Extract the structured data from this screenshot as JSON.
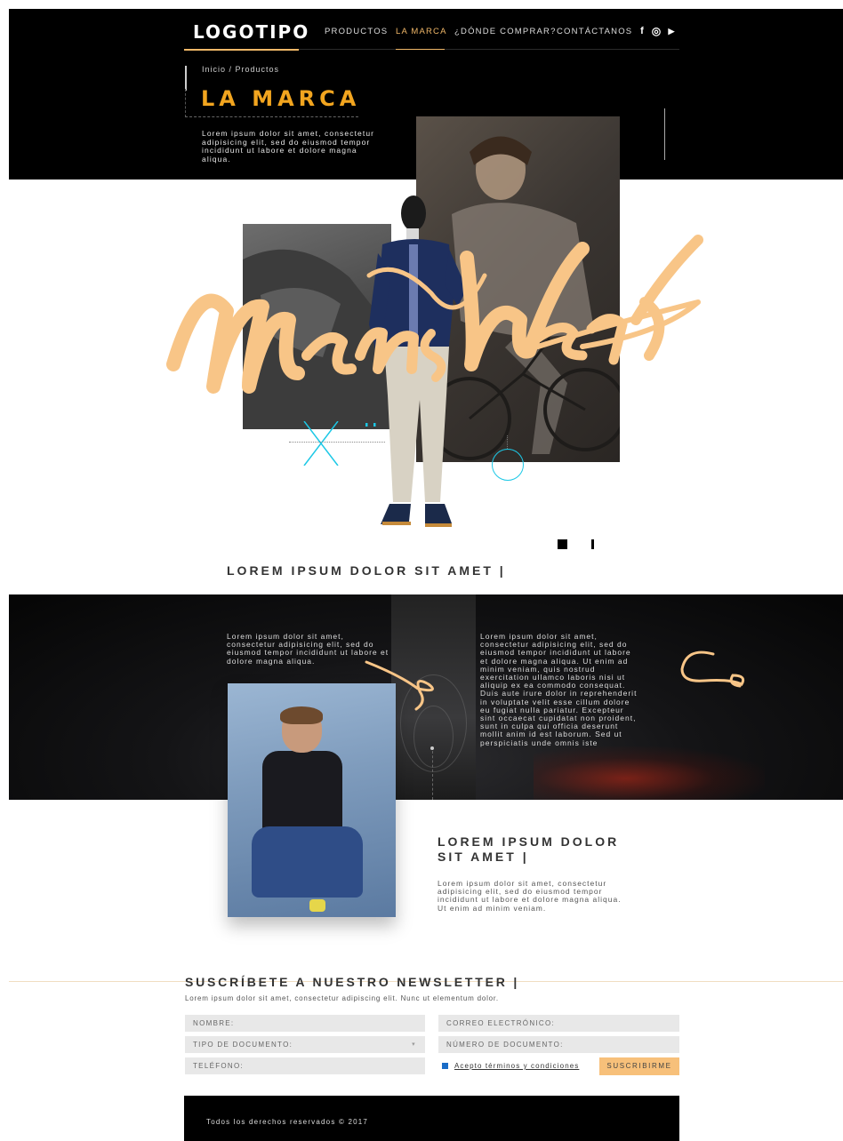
{
  "header": {
    "logo": "LOGOTIPO",
    "nav": [
      {
        "label": "PRODUCTOS",
        "active": false
      },
      {
        "label": "LA MARCA",
        "active": true
      },
      {
        "label": "¿DÓNDE COMPRAR?",
        "active": false
      },
      {
        "label": "CONTÁCTANOS",
        "active": false
      }
    ],
    "social": [
      "facebook-icon",
      "instagram-icon",
      "youtube-icon"
    ],
    "social_glyphs": [
      "f",
      "◎",
      "▶"
    ]
  },
  "hero": {
    "breadcrumb": "Inicio / Productos",
    "title": "LA MARCA",
    "intro": "Lorem ipsum dolor sit amet, consectetur adipisicing elit, sed do eiusmod tempor incididunt ut labore et dolore magna aliqua.",
    "script_text": "MensWear",
    "tagline": "LOREM IPSUM DOLOR SIT AMET   |"
  },
  "dark_section": {
    "text_left": "Lorem ipsum dolor sit amet, consectetur adipisicing elit, sed do eiusmod tempor incididunt ut labore et dolore magna aliqua.",
    "text_right": "Lorem ipsum dolor sit amet, consectetur adipisicing elit, sed do eiusmod tempor incididunt ut labore et dolore magna aliqua. Ut enim ad minim veniam, quis nostrud exercitation ullamco laboris nisi ut aliquip ex ea commodo consequat. Duis aute irure dolor in reprehenderit in voluptate velit esse cillum dolore eu fugiat nulla pariatur. Excepteur sint occaecat cupidatat non proident, sunt in culpa qui officia deserunt mollit anim id est laborum. Sed ut perspiciatis unde omnis iste"
  },
  "feature": {
    "title": "LOREM IPSUM DOLOR SIT AMET   |",
    "text": "Lorem ipsum dolor sit amet, consectetur adipisicing elit, sed do eiusmod tempor incididunt ut labore et dolore magna aliqua. Ut enim ad minim veniam."
  },
  "newsletter": {
    "title": "SUSCRÍBETE A NUESTRO NEWSLETTER   |",
    "subtitle": "Lorem ipsum dolor sit amet, consectetur adipiscing elit. Nunc ut elementum dolor.",
    "fields": {
      "name": "NOMBRE:",
      "email": "CORREO ELECTRÓNICO:",
      "doc_type": "TIPO DE DOCUMENTO:",
      "doc_number": "NÚMERO DE DOCUMENTO:",
      "phone": "TELÉFONO:"
    },
    "terms": "Acepto términos y condiciones",
    "terms_checked": true,
    "submit": "SUSCRIBIRME"
  },
  "footer": {
    "copyright": "Todos los derechos reservados © 2017"
  },
  "colors": {
    "accent": "#f2a51f",
    "accent_light": "#f7c07a",
    "cyan": "#1cc8e6",
    "dark": "#000000"
  }
}
